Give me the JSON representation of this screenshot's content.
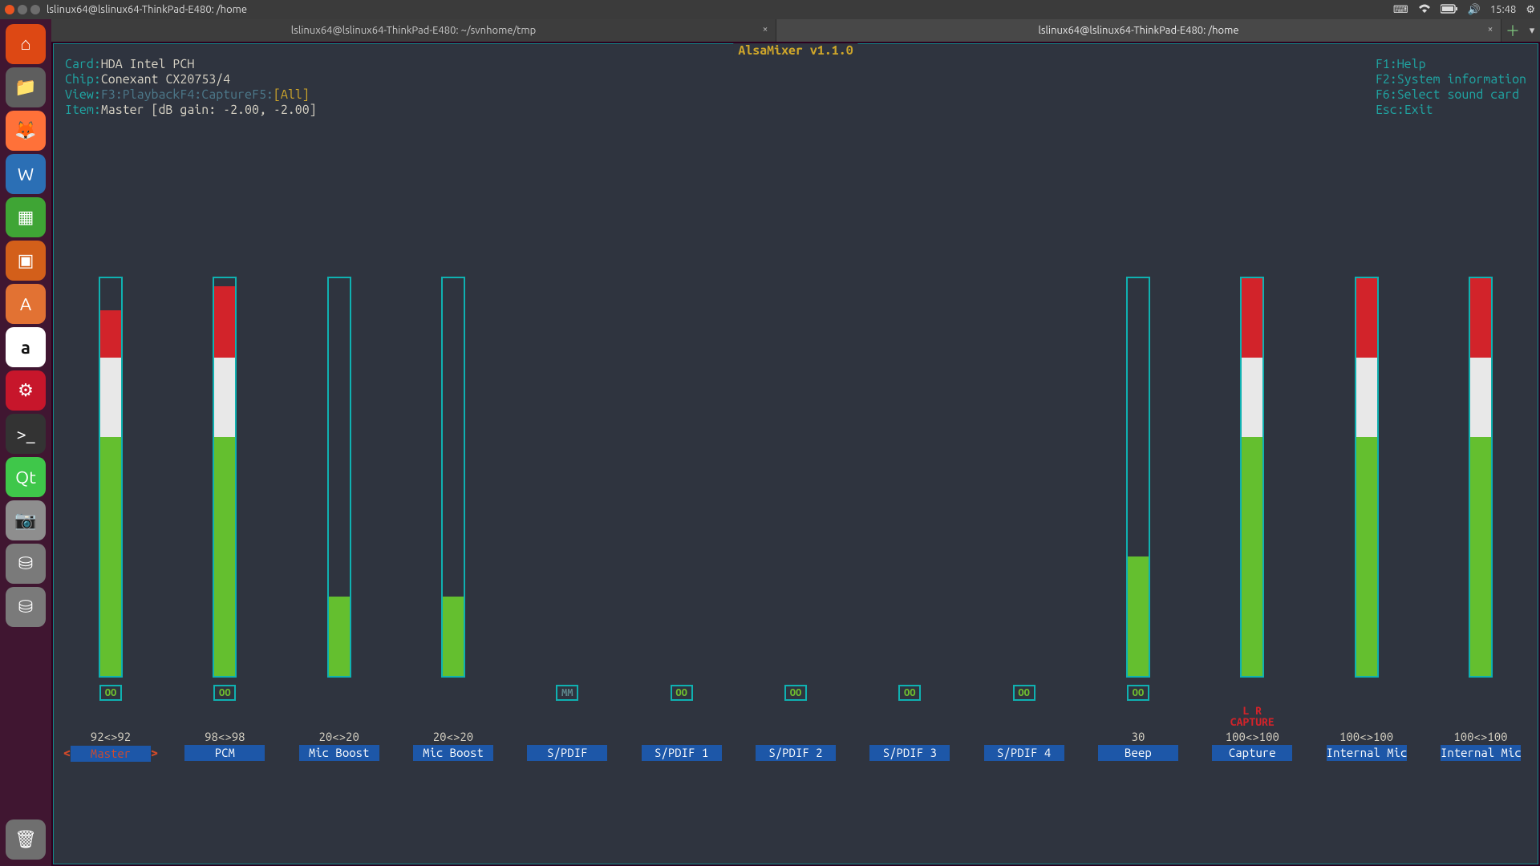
{
  "panel": {
    "title": "lslinux64@lslinux64-ThinkPad-E480: /home",
    "clock": "15:48"
  },
  "tabs": {
    "t1": "lslinux64@lslinux64-ThinkPad-E480: ~/svnhome/tmp",
    "t2": "lslinux64@lslinux64-ThinkPad-E480: /home"
  },
  "launcher": {
    "ubuntu": "⌂",
    "files": "📁",
    "firefox": "🦊",
    "writer": "W",
    "calc": "▦",
    "impress": "▣",
    "soft": "A",
    "amazon": "a",
    "settings": "⚙",
    "term": ">_",
    "qt": "Qt",
    "shot": "📷",
    "disk": "⛁",
    "disk2": "⛁",
    "trash": "🗑"
  },
  "app": {
    "title": "AlsaMixer v1.1.0",
    "card_k": "Card: ",
    "card_v": "HDA Intel PCH",
    "chip_k": "Chip: ",
    "chip_v": "Conexant CX20753/4",
    "view_k": "View: ",
    "view_f3": "F3:",
    "view_pb": " Playback ",
    "view_f4": " F4:",
    "view_cap": " Capture ",
    "view_f5": " F5:",
    "view_all": "[All]",
    "item_k": "Item: ",
    "item_v": "Master [dB gain: -2.00, -2.00]",
    "help_k": "F1:",
    "help_v": "  Help",
    "sys_k": "F2:",
    "sys_v": "  System information",
    "sel_k": "F6:",
    "sel_v": "  Select sound card",
    "esc_k": "Esc:",
    "esc_v": " Exit"
  },
  "channels": [
    {
      "name": "Master",
      "value": "92<>92",
      "level": 92,
      "mute": "OO",
      "selected": true
    },
    {
      "name": "PCM",
      "value": "98<>98",
      "level": 98,
      "mute": "OO"
    },
    {
      "name": "Mic Boost",
      "value": "20<>20",
      "level": 20,
      "mute": null
    },
    {
      "name": "Mic Boost",
      "value": "20<>20",
      "level": 20,
      "mute": null
    },
    {
      "name": "S/PDIF",
      "value": "",
      "level": -1,
      "mute": "MM"
    },
    {
      "name": "S/PDIF 1",
      "value": "",
      "level": -1,
      "mute": "OO"
    },
    {
      "name": "S/PDIF 2",
      "value": "",
      "level": -1,
      "mute": "OO"
    },
    {
      "name": "S/PDIF 3",
      "value": "",
      "level": -1,
      "mute": "OO"
    },
    {
      "name": "S/PDIF 4",
      "value": "",
      "level": -1,
      "mute": "OO"
    },
    {
      "name": "Beep",
      "value": "30",
      "level": 30,
      "mute": "OO"
    },
    {
      "name": "Capture",
      "value": "100<>100",
      "level": 100,
      "mute": null,
      "capture": true
    },
    {
      "name": "Internal Mic B",
      "value": "100<>100",
      "level": 100,
      "mute": null
    },
    {
      "name": "Internal Mic B",
      "value": "100<>100",
      "level": 100,
      "mute": null
    }
  ],
  "caplabel": {
    "lr": "L   R",
    "cap": "CAPTURE"
  }
}
